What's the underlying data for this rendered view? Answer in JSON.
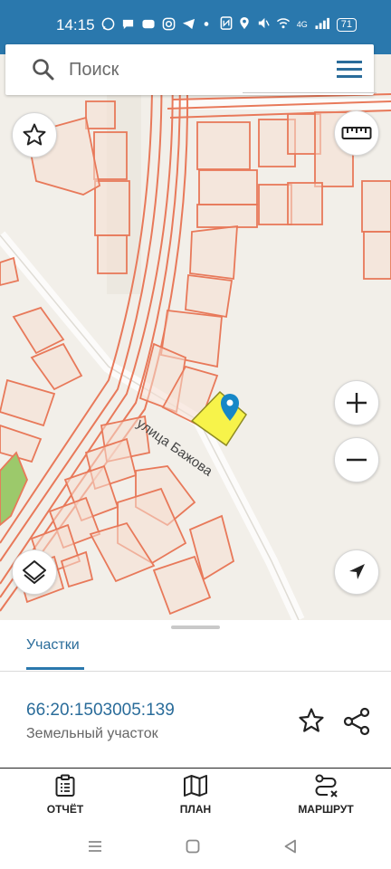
{
  "status_bar": {
    "time": "14:15",
    "left_icons": [
      "whatsapp-icon",
      "chat-icon",
      "cloud-icon",
      "instagram-icon",
      "telegram-icon",
      "dot-icon"
    ],
    "right_icons": [
      "nfc-icon",
      "location-icon",
      "mute-icon",
      "wifi-icon",
      "signal-icon"
    ],
    "network": "4G",
    "battery": "71"
  },
  "search": {
    "placeholder": "Поиск"
  },
  "map": {
    "street_label": "улица Бажова",
    "selected_parcel_color": "#f7f34a",
    "pin_color": "#1787c7",
    "boundary_color": "#e8795a"
  },
  "map_controls": [
    "favorite-star",
    "ruler",
    "zoom-in",
    "zoom-out",
    "layers",
    "my-location"
  ],
  "sheet": {
    "tab_label": "Участки",
    "parcel_id": "66:20:1503005:139",
    "parcel_type": "Земельный участок"
  },
  "actions": [
    {
      "label": "ОТЧЁТ",
      "icon": "report-icon"
    },
    {
      "label": "ПЛАН",
      "icon": "map-plan-icon"
    },
    {
      "label": "МАРШРУТ",
      "icon": "route-icon"
    }
  ],
  "colors": {
    "accent": "#2a78ad",
    "link": "#2a6c9a"
  }
}
